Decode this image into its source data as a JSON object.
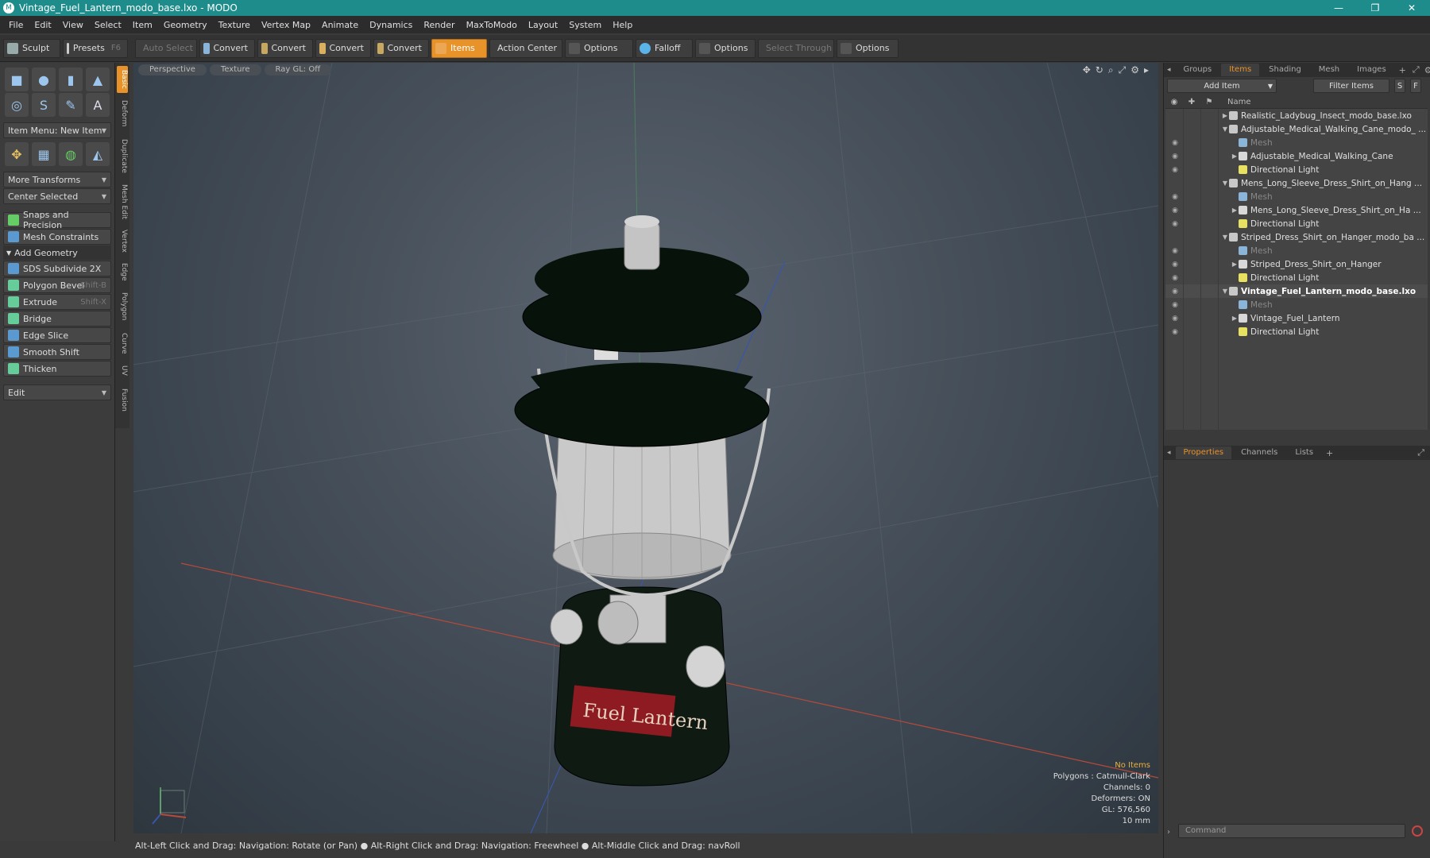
{
  "window": {
    "title": "Vintage_Fuel_Lantern_modo_base.lxo - MODO",
    "app_icon": "M",
    "minimize": "—",
    "maximize": "❐",
    "close": "✕"
  },
  "menu": [
    "File",
    "Edit",
    "View",
    "Select",
    "Item",
    "Geometry",
    "Texture",
    "Vertex Map",
    "Animate",
    "Dynamics",
    "Render",
    "MaxToModo",
    "Layout",
    "System",
    "Help"
  ],
  "toolbar": {
    "sculpt": "Sculpt",
    "presets": "Presets",
    "presets_key": "F6",
    "auto_select": "Auto Select",
    "convert1": "Convert",
    "convert2": "Convert",
    "convert3": "Convert",
    "convert4": "Convert",
    "items": "Items",
    "action_center": "Action Center",
    "options1": "Options",
    "falloff": "Falloff",
    "options2": "Options",
    "select_through": "Select Through",
    "options3": "Options"
  },
  "left": {
    "item_menu": "Item Menu: New Item",
    "more_transforms": "More Transforms",
    "center_selected": "Center Selected",
    "snaps": "Snaps and Precision",
    "mesh_constraints": "Mesh Constraints",
    "add_geometry": "Add Geometry",
    "tools": [
      {
        "label": "SDS Subdivide 2X",
        "shortcut": ""
      },
      {
        "label": "Polygon Bevel",
        "shortcut": "Shift-B"
      },
      {
        "label": "Extrude",
        "shortcut": "Shift-X"
      },
      {
        "label": "Bridge",
        "shortcut": ""
      },
      {
        "label": "Edge Slice",
        "shortcut": ""
      },
      {
        "label": "Smooth Shift",
        "shortcut": ""
      },
      {
        "label": "Thicken",
        "shortcut": ""
      }
    ],
    "edit": "Edit"
  },
  "vtabs": [
    "Basic",
    "Deform",
    "Duplicate",
    "Mesh Edit",
    "Vertex",
    "Edge",
    "Polygon",
    "Curve",
    "UV",
    "Fusion"
  ],
  "viewport": {
    "tabs": [
      "Perspective",
      "Texture",
      "Ray GL: Off"
    ],
    "info": {
      "items": "No Items",
      "polygons": "Polygons : Catmull-Clark",
      "channels": "Channels: 0",
      "deformers": "Deformers: ON",
      "gl": "GL: 576,560",
      "scale": "10 mm"
    },
    "label_text": "Fuel Lantern"
  },
  "status": "Alt-Left Click and Drag: Navigation: Rotate (or Pan) ● Alt-Right Click and Drag: Navigation: Freewheel ● Alt-Middle Click and Drag: navRoll",
  "right": {
    "tabs": [
      "Groups",
      "Items",
      "Shading",
      "Mesh ...",
      "Images"
    ],
    "add_item": "Add Item",
    "filter_items": "Filter Items",
    "filter_s": "S",
    "filter_f": "F",
    "name_header": "Name",
    "tree": [
      {
        "label": "Realistic_Ladybug_Insect_modo_base.lxo",
        "level": 0,
        "arrow": "▶",
        "type": "scene",
        "eye": "",
        "dim": false,
        "bold": false
      },
      {
        "label": "Adjustable_Medical_Walking_Cane_modo_ ...",
        "level": 0,
        "arrow": "▼",
        "type": "scene",
        "eye": "",
        "dim": false,
        "bold": false
      },
      {
        "label": "Mesh",
        "level": 1,
        "arrow": "",
        "type": "mesh",
        "eye": "◉",
        "dim": true,
        "bold": false
      },
      {
        "label": "Adjustable_Medical_Walking_Cane",
        "level": 1,
        "arrow": "▶",
        "type": "group",
        "eye": "◉",
        "dim": false,
        "bold": false
      },
      {
        "label": "Directional Light",
        "level": 1,
        "arrow": "",
        "type": "light",
        "eye": "◉",
        "dim": false,
        "bold": false
      },
      {
        "label": "Mens_Long_Sleeve_Dress_Shirt_on_Hang ...",
        "level": 0,
        "arrow": "▼",
        "type": "scene",
        "eye": "",
        "dim": false,
        "bold": false
      },
      {
        "label": "Mesh",
        "level": 1,
        "arrow": "",
        "type": "mesh",
        "eye": "◉",
        "dim": true,
        "bold": false
      },
      {
        "label": "Mens_Long_Sleeve_Dress_Shirt_on_Ha ...",
        "level": 1,
        "arrow": "▶",
        "type": "group",
        "eye": "◉",
        "dim": false,
        "bold": false
      },
      {
        "label": "Directional Light",
        "level": 1,
        "arrow": "",
        "type": "light",
        "eye": "◉",
        "dim": false,
        "bold": false
      },
      {
        "label": "Striped_Dress_Shirt_on_Hanger_modo_ba ...",
        "level": 0,
        "arrow": "▼",
        "type": "scene",
        "eye": "",
        "dim": false,
        "bold": false
      },
      {
        "label": "Mesh",
        "level": 1,
        "arrow": "",
        "type": "mesh",
        "eye": "◉",
        "dim": true,
        "bold": false
      },
      {
        "label": "Striped_Dress_Shirt_on_Hanger",
        "level": 1,
        "arrow": "▶",
        "type": "group",
        "eye": "◉",
        "dim": false,
        "bold": false
      },
      {
        "label": "Directional Light",
        "level": 1,
        "arrow": "",
        "type": "light",
        "eye": "◉",
        "dim": false,
        "bold": false
      },
      {
        "label": "Vintage_Fuel_Lantern_modo_base.lxo",
        "level": 0,
        "arrow": "▼",
        "type": "scene",
        "eye": "◉",
        "dim": false,
        "bold": true
      },
      {
        "label": "Mesh",
        "level": 1,
        "arrow": "",
        "type": "mesh",
        "eye": "◉",
        "dim": true,
        "bold": false
      },
      {
        "label": "Vintage_Fuel_Lantern",
        "level": 1,
        "arrow": "▶",
        "type": "group",
        "eye": "◉",
        "dim": false,
        "bold": false
      },
      {
        "label": "Directional Light",
        "level": 1,
        "arrow": "",
        "type": "light",
        "eye": "◉",
        "dim": false,
        "bold": false
      }
    ],
    "prop_tabs": [
      "Properties",
      "Channels",
      "Lists"
    ],
    "command_placeholder": "Command"
  },
  "colors": {
    "accent": "#e8922a",
    "titlebar": "#1f8c8c"
  }
}
